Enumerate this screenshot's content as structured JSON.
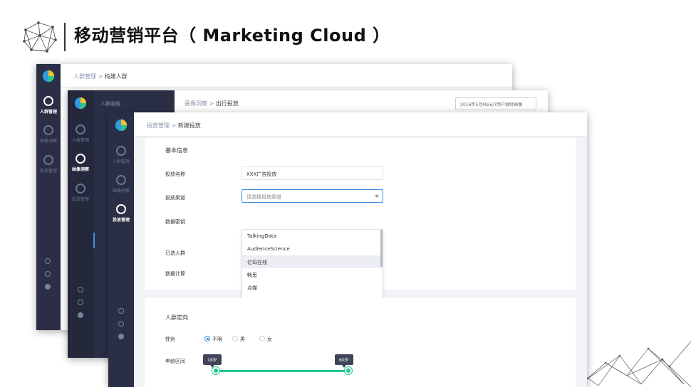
{
  "slide": {
    "title": "移动营销平台（ Marketing Cloud ）"
  },
  "window_back": {
    "breadcrumb_parent": "人群管理",
    "breadcrumb_sep": " > ",
    "breadcrumb_current": "构建人群",
    "sidebar": [
      {
        "label": "人群管理",
        "icon": "crowd-icon",
        "active": true
      },
      {
        "label": "画像洞察",
        "icon": "insight-icon",
        "active": false
      },
      {
        "label": "投放管理",
        "icon": "delivery-icon",
        "active": false
      }
    ]
  },
  "window_middle": {
    "breadcrumb_parent": "画像洞察",
    "breadcrumb_sep": " > ",
    "breadcrumb_current": "出行投放",
    "date_select": "2016年5月Male/7用户独特画像",
    "sidebar_group": "人群画像",
    "sidebar": [
      {
        "label": "人群管理",
        "icon": "crowd-icon",
        "active": false
      },
      {
        "label": "画像洞察",
        "icon": "insight-icon",
        "active": true
      },
      {
        "label": "投放管理",
        "icon": "delivery-icon",
        "active": false
      }
    ]
  },
  "window_front": {
    "breadcrumb_parent": "投放管理",
    "breadcrumb_sep": " > ",
    "breadcrumb_current": "新建投放",
    "sidebar": [
      {
        "label": "人群管理",
        "icon": "crowd-icon",
        "active": false
      },
      {
        "label": "画像洞察",
        "icon": "insight-icon",
        "active": false
      },
      {
        "label": "投放管理",
        "icon": "delivery-icon",
        "active": true
      }
    ],
    "basic_info": {
      "title": "基本信息",
      "name_label": "投放名称",
      "name_value": "XXX广告投放",
      "channel_label": "投放渠道",
      "channel_placeholder": "请选择投放渠道",
      "channel_options": [
        "TalkingData",
        "AudienceScience",
        "亿玛在线",
        "畅思",
        "点媒"
      ],
      "hovered_option": 2,
      "secret_label": "数据密钥",
      "selected_crowd_label": "已选人群",
      "compute_label": "数据计算"
    },
    "targeting": {
      "title": "人群定向",
      "gender_label": "性别",
      "gender_options": [
        "不限",
        "男",
        "女"
      ],
      "gender_selected": 0,
      "age_label": "年龄区间",
      "age_min": "18岁",
      "age_max": "60岁"
    }
  },
  "colors": {
    "sidebar": "#2a2f45",
    "accent_blue": "#3d8fe0",
    "slider_green": "#1fc78f"
  }
}
